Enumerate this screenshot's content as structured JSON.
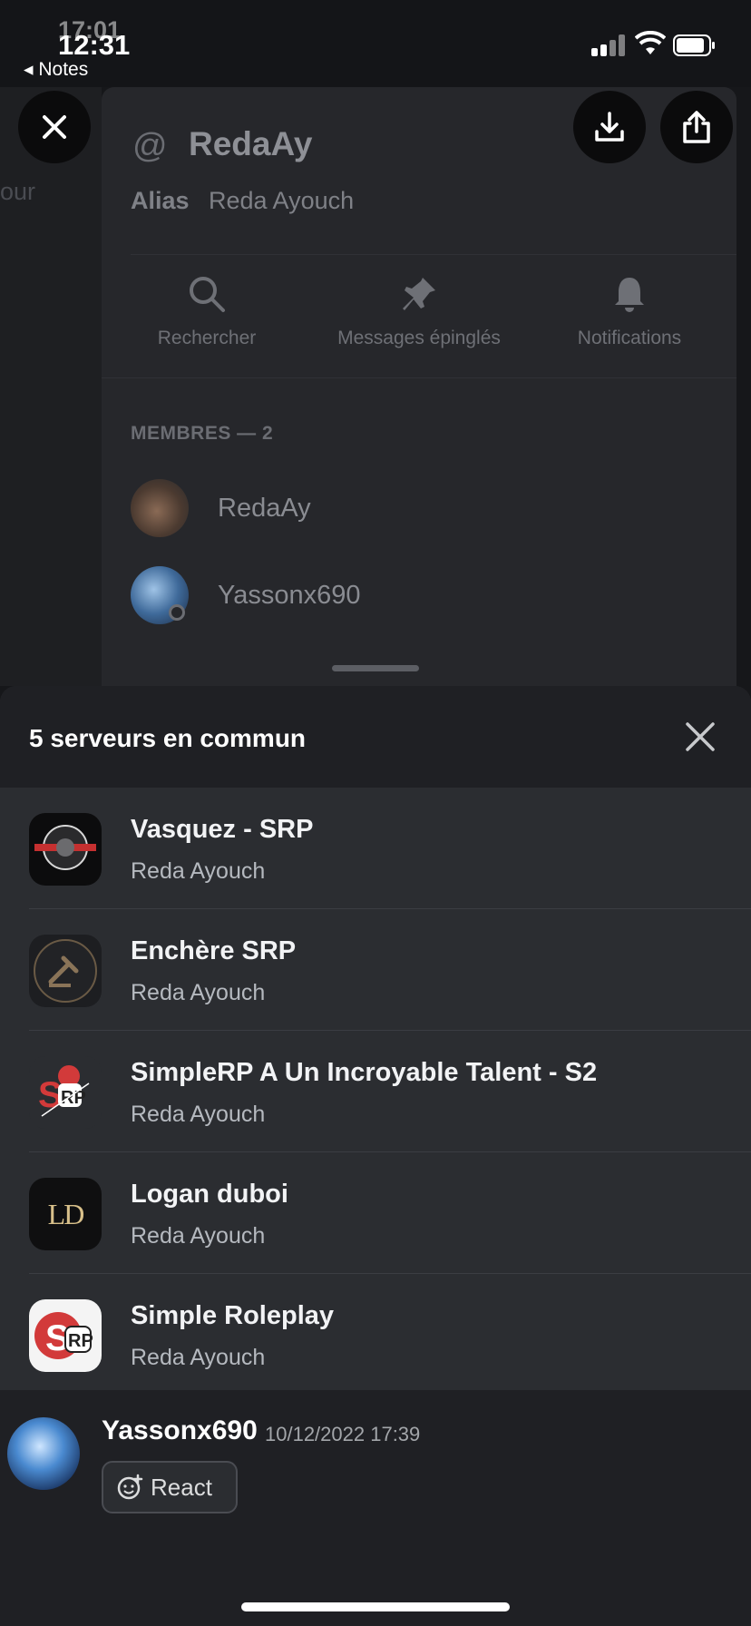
{
  "status_bar": {
    "time": "12:31",
    "time_ghost": "17:01",
    "back_app": "◂ Notes"
  },
  "background": {
    "left_text": "our",
    "channel": {
      "at_symbol": "@",
      "title": "RedaAy",
      "alias_label": "Alias",
      "alias_value": "Reda Ayouch"
    },
    "actions": [
      {
        "label": "Rechercher",
        "icon": "search-icon"
      },
      {
        "label": "Messages épinglés",
        "icon": "pin-icon"
      },
      {
        "label": "Notifications",
        "icon": "bell-icon"
      }
    ],
    "members_header": "MEMBRES — 2",
    "members": [
      {
        "name": "RedaAy"
      },
      {
        "name": "Yassonx690"
      }
    ]
  },
  "overlay_buttons": {
    "close": "close-icon",
    "download": "download-icon",
    "share": "share-icon"
  },
  "sheet": {
    "title": "5 serveurs en commun",
    "servers": [
      {
        "name": "Vasquez - SRP",
        "sub": "Reda Ayouch"
      },
      {
        "name": "Enchère SRP",
        "sub": "Reda Ayouch"
      },
      {
        "name": "SimpleRP A Un Incroyable Talent - S2",
        "sub": "Reda Ayouch"
      },
      {
        "name": "Logan duboi",
        "sub": "Reda Ayouch",
        "icon_text": "LD"
      },
      {
        "name": "Simple Roleplay",
        "sub": "Reda Ayouch"
      }
    ]
  },
  "message": {
    "author": "Yassonx690",
    "timestamp": "10/12/2022 17:39",
    "react_label": "React"
  },
  "colors": {
    "sheet_bg": "#2b2d31",
    "header_bg": "#1f2024",
    "accent_red": "#d23a3a"
  }
}
